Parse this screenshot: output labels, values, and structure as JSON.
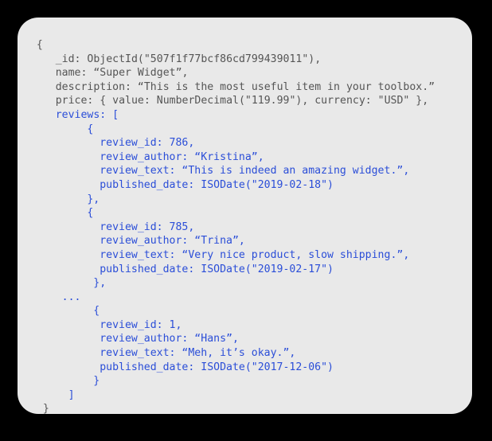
{
  "card": {
    "background_color": "#e9e9e9",
    "page_background_color": "#000000",
    "corner_radius": "26px"
  },
  "colors": {
    "document_field_text": "#555555",
    "reviews_text": "#2b4ed8"
  },
  "document": {
    "language": "mongodb-document",
    "lines": [
      {
        "id": "line-open-brace",
        "indent": 1,
        "color": "gray",
        "text": "{"
      },
      {
        "id": "line-id",
        "indent": 4,
        "color": "gray",
        "text": "_id: ObjectId(\"507f1f77bcf86cd799439011\"),"
      },
      {
        "id": "line-name",
        "indent": 4,
        "color": "gray",
        "text": "name: “Super Widget”,"
      },
      {
        "id": "line-description",
        "indent": 4,
        "color": "gray",
        "text": "description: “This is the most useful item in your toolbox.”"
      },
      {
        "id": "line-price",
        "indent": 4,
        "color": "gray",
        "text": "price: { value: NumberDecimal(\"119.99\"), currency: \"USD\" },"
      },
      {
        "id": "line-reviews-open",
        "indent": 4,
        "color": "blue",
        "text": "reviews: ["
      },
      {
        "id": "line-review1-open",
        "indent": 9,
        "color": "blue",
        "text": "{"
      },
      {
        "id": "line-review1-id",
        "indent": 11,
        "color": "blue",
        "text": "review_id: 786,"
      },
      {
        "id": "line-review1-author",
        "indent": 11,
        "color": "blue",
        "text": "review_author: “Kristina”,"
      },
      {
        "id": "line-review1-text",
        "indent": 11,
        "color": "blue",
        "text": "review_text: “This is indeed an amazing widget.”,"
      },
      {
        "id": "line-review1-date",
        "indent": 11,
        "color": "blue",
        "text": "published_date: ISODate(\"2019-02-18\")"
      },
      {
        "id": "line-review1-close",
        "indent": 9,
        "color": "blue",
        "text": "},"
      },
      {
        "id": "line-review2-open",
        "indent": 9,
        "color": "blue",
        "text": "{"
      },
      {
        "id": "line-review2-id",
        "indent": 11,
        "color": "blue",
        "text": "review_id: 785,"
      },
      {
        "id": "line-review2-author",
        "indent": 11,
        "color": "blue",
        "text": "review_author: “Trina”,"
      },
      {
        "id": "line-review2-text",
        "indent": 11,
        "color": "blue",
        "text": "review_text: “Very nice product, slow shipping.”,"
      },
      {
        "id": "line-review2-date",
        "indent": 11,
        "color": "blue",
        "text": "published_date: ISODate(\"2019-02-17\")"
      },
      {
        "id": "line-review2-close",
        "indent": 10,
        "color": "blue",
        "text": "},"
      },
      {
        "id": "line-ellipsis",
        "indent": 5,
        "color": "blue",
        "text": "..."
      },
      {
        "id": "line-review3-open",
        "indent": 10,
        "color": "blue",
        "text": "{"
      },
      {
        "id": "line-review3-id",
        "indent": 11,
        "color": "blue",
        "text": "review_id: 1,"
      },
      {
        "id": "line-review3-author",
        "indent": 11,
        "color": "blue",
        "text": "review_author: “Hans”,"
      },
      {
        "id": "line-review3-text",
        "indent": 11,
        "color": "blue",
        "text": "review_text: “Meh, it’s okay.”,"
      },
      {
        "id": "line-review3-date",
        "indent": 11,
        "color": "blue",
        "text": "published_date: ISODate(\"2017-12-06\")"
      },
      {
        "id": "line-review3-close",
        "indent": 10,
        "color": "blue",
        "text": "}"
      },
      {
        "id": "line-reviews-close",
        "indent": 6,
        "color": "blue",
        "text": "]"
      },
      {
        "id": "line-close-brace",
        "indent": 2,
        "color": "gray",
        "text": "}"
      }
    ]
  }
}
